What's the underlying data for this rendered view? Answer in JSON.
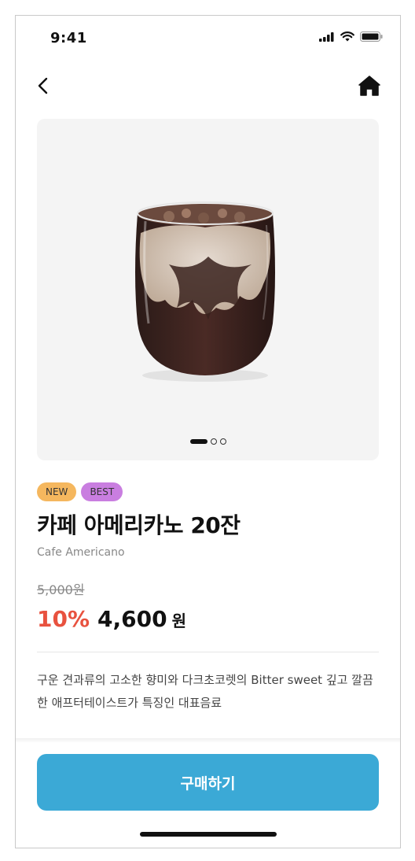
{
  "status_bar": {
    "time": "9:41",
    "signal_icon": "signal-icon",
    "wifi_icon": "wifi-icon",
    "battery_icon": "battery-icon"
  },
  "nav": {
    "back_icon": "chevron-left-icon",
    "home_icon": "home-icon"
  },
  "gallery": {
    "image_alt": "Cafe Americano",
    "total_slides": 3,
    "active_slide": 1
  },
  "product": {
    "badges": [
      {
        "label": "NEW",
        "color": "#f5b75e"
      },
      {
        "label": "BEST",
        "color": "#c97ee0"
      }
    ],
    "title": "카페 아메리카노 20잔",
    "subtitle": "Cafe Americano",
    "original_price": "5,000원",
    "discount": "10%",
    "price": "4,600",
    "currency": "원",
    "description": "구운 견과류의 고소한 향미와 다크초코렛의 Bitter sweet 깊고 깔끔한 애프터테이스트가 특징인 대표음료"
  },
  "actions": {
    "buy_label": "구매하기"
  },
  "colors": {
    "accent": "#3ba9d6",
    "discount": "#e8523f",
    "hero_bg": "#f4f4f4"
  }
}
